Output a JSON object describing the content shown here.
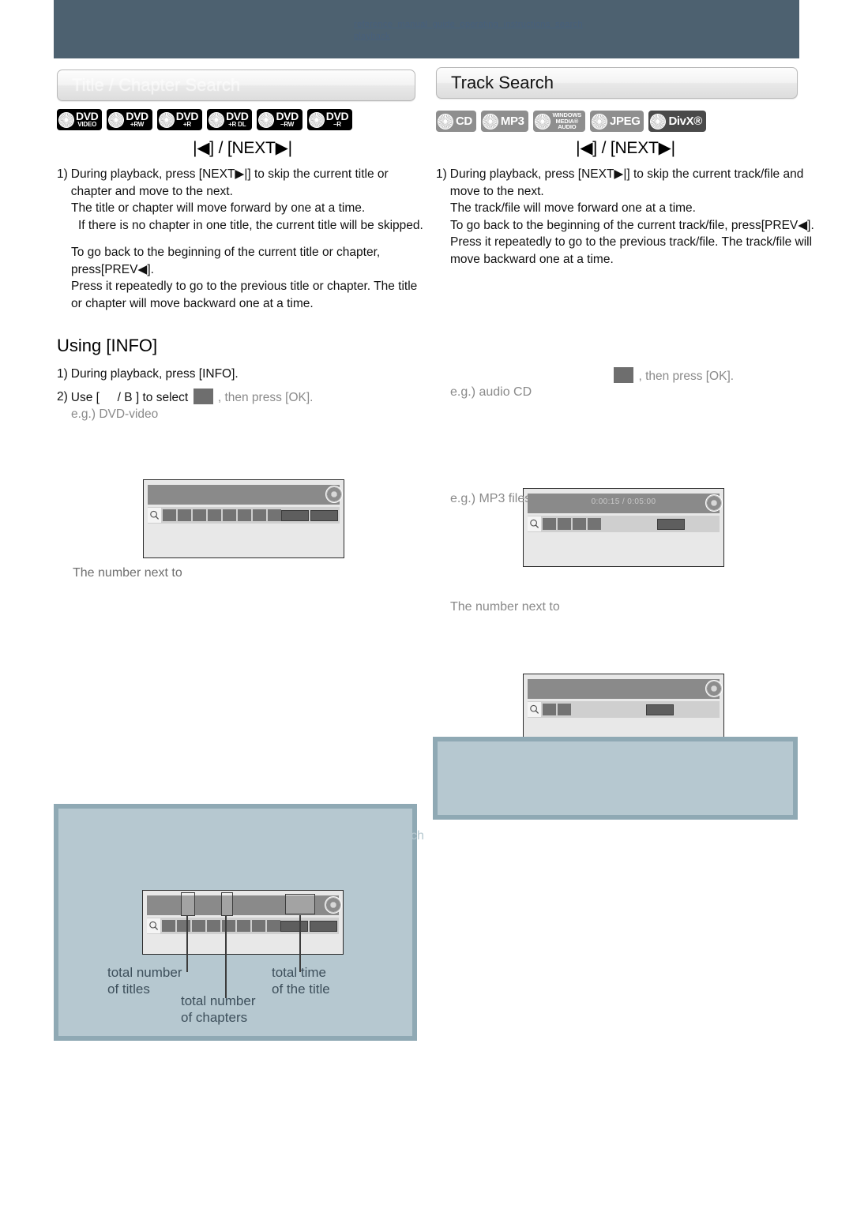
{
  "header": {
    "faint_text": "reference   manual   guide   operating   instructions   search   playback"
  },
  "left_section": {
    "plaque_title": "Title / Chapter Search",
    "logos": [
      {
        "main": "DVD",
        "sub": "VIDEO"
      },
      {
        "main": "DVD",
        "sub": "+RW"
      },
      {
        "main": "DVD",
        "sub": "+R"
      },
      {
        "main": "DVD",
        "sub": "+R DL"
      },
      {
        "main": "DVD",
        "sub": "–RW"
      },
      {
        "main": "DVD",
        "sub": "–R"
      }
    ],
    "skip_heading": "|◀] / [NEXT▶|",
    "steps": [
      {
        "n": "1)",
        "text": "During playback, press [NEXT▶|] to skip the current title or chapter and move to the next."
      },
      {
        "text": "The title or chapter will move forward by one at a time."
      },
      {
        "text": "If there is no chapter in one title, the current title will be skipped."
      },
      {
        "text": "To go back to the beginning of the current title or chapter, press[PREV◀]."
      },
      {
        "text": "Press it repeatedly to go to the previous title or chapter. The title or chapter will move backward one at a time."
      }
    ],
    "using_info_heading": "Using [INFO]",
    "info_step1_n": "1)",
    "info_step1": "During playback, press [INFO].",
    "info_step2_n": "2)",
    "info_step2_a": "Use [",
    "info_step2_b": "/ B ] to select",
    "info_step2_c": ", then press [OK].",
    "example_label": "e.g.) DVD-video",
    "number_note": "The number next to"
  },
  "right_section": {
    "plaque_title": "Track Search",
    "logos": [
      {
        "type": "cd",
        "label": "CD"
      },
      {
        "type": "mp3",
        "label": "MP3"
      },
      {
        "type": "wma",
        "l1": "WINDOWS",
        "l2": "MEDIA®",
        "l3": "AUDIO"
      },
      {
        "type": "jpeg",
        "label": "JPEG"
      },
      {
        "type": "divx",
        "label": "DivX®"
      }
    ],
    "skip_heading": "|◀] / [NEXT▶|",
    "steps": [
      {
        "n": "1)",
        "text": "During playback, press [NEXT▶|] to skip the current track/file and move to the next."
      },
      {
        "text": "The track/file will move forward one at a time."
      },
      {
        "text": "To go back to the beginning of the current track/file, press[PREV◀]."
      },
      {
        "text": "Press it repeatedly to go to the previous track/file. The track/file will move backward one at a time."
      }
    ],
    "select_tail": ", then press [OK].",
    "example_cd": "e.g.) audio CD",
    "example_mp3": "e.g.) MP3 files",
    "cd_osd_time": "0:00:15 / 0:05:00",
    "number_note": "The number next to"
  },
  "callouts": {
    "total_titles": "total number\nof titles",
    "total_chapters": "total number\nof chapters",
    "total_time": "total time\nof the title",
    "total_titles_l1": "total number",
    "total_titles_l2": "of titles",
    "total_chapters_l1": "total number",
    "total_chapters_l2": "of chapters",
    "total_time_l1": "total time",
    "total_time_l2": "of the title"
  },
  "stray": {
    "fragment": "ch"
  },
  "colors": {
    "header_band": "#4d6170",
    "blue_box_fill": "#b6c8d0",
    "blue_box_border": "#8fa9b4",
    "osd_top_bar": "#8a8a8a",
    "osd_bottom_bar": "#cfcfcf",
    "osd_block": "#737373",
    "callout_text": "#3d4f5b"
  }
}
